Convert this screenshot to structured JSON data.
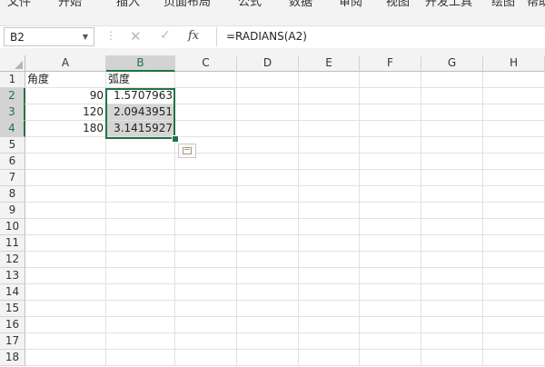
{
  "ribbon": {
    "tabs": [
      "文件",
      "开始",
      "插入",
      "页面布局",
      "公式",
      "数据",
      "审阅",
      "视图",
      "开发工具",
      "绘图",
      "帮助"
    ]
  },
  "formula_bar": {
    "name_box": "B2",
    "fx_label": "fx",
    "formula": "=RADIANS(A2)"
  },
  "grid": {
    "columns": [
      "A",
      "B",
      "C",
      "D",
      "E",
      "F",
      "G",
      "H"
    ],
    "rows": [
      "1",
      "2",
      "3",
      "4",
      "5",
      "6",
      "7",
      "8",
      "9",
      "10",
      "11",
      "12",
      "13",
      "14",
      "15",
      "16",
      "17",
      "18"
    ],
    "cells": {
      "A1": "角度",
      "B1": "弧度",
      "A2": "90",
      "B2": "1.5707963",
      "A3": "120",
      "B3": "2.0943951",
      "A4": "180",
      "B4": "3.1415927"
    }
  },
  "colors": {
    "accent": "#217346",
    "header_bg": "#f3f3f3",
    "selection_bg": "#d5d5d5"
  }
}
